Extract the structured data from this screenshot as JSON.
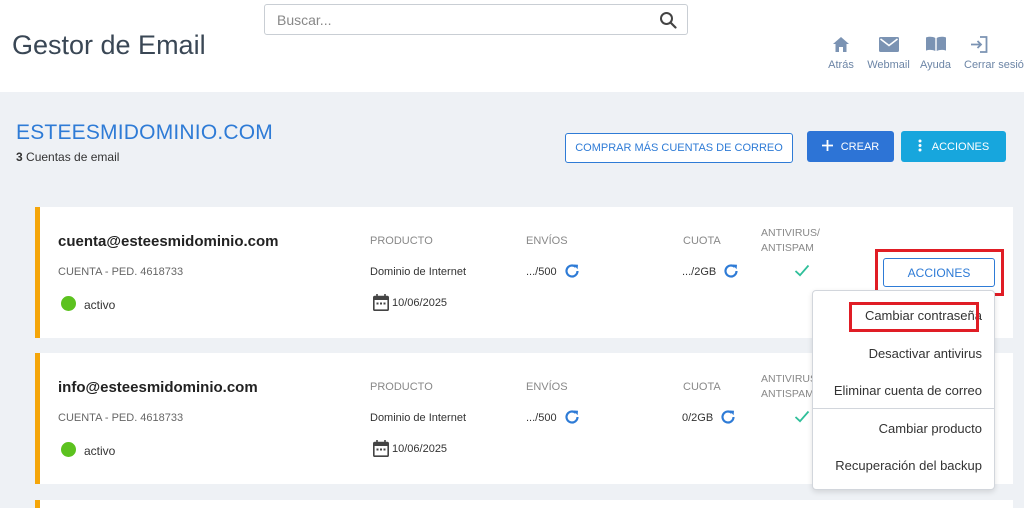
{
  "header": {
    "title": "Gestor de Email",
    "search_placeholder": "Buscar...",
    "nav": [
      {
        "label": "Atrás",
        "icon": "home-icon"
      },
      {
        "label": "Webmail",
        "icon": "mail-icon"
      },
      {
        "label": "Ayuda",
        "icon": "book-icon"
      },
      {
        "label": "Cerrar sesión",
        "icon": "logout-icon"
      }
    ]
  },
  "domain": {
    "name": "ESTEESMIDOMINIO.COM",
    "count": "3",
    "count_label": "Cuentas de email",
    "buy_button": "COMPRAR MÁS CUENTAS DE CORREO",
    "create_button": "CREAR",
    "actions_button": "ACCIONES"
  },
  "columns": {
    "producto": "PRODUCTO",
    "envios": "ENVÍOS",
    "cuota": "CUOTA",
    "antivirus": "ANTIVIRUS/",
    "antispam": "ANTISPAM"
  },
  "accounts": [
    {
      "email": "cuenta@esteesmidominio.com",
      "ref": "CUENTA - PED. 4618733",
      "status": "activo",
      "product": "Dominio de Internet",
      "date": "10/06/2025",
      "envios": ".../500",
      "cuota": ".../2GB",
      "actions_button": "ACCIONES"
    },
    {
      "email": "info@esteesmidominio.com",
      "ref": "CUENTA - PED. 4618733",
      "status": "activo",
      "product": "Dominio de Internet",
      "date": "10/06/2025",
      "envios": ".../500",
      "cuota": "0/2GB"
    }
  ],
  "dropdown": {
    "items": [
      "Cambiar contraseña",
      "Desactivar antivirus",
      "Eliminar cuenta de correo",
      "Cambiar producto",
      "Recuperación del backup"
    ]
  },
  "colors": {
    "accent": "#2e7bd6",
    "card_border": "#f5a60a",
    "status_active": "#5cc21f",
    "highlight": "#e01d25"
  }
}
